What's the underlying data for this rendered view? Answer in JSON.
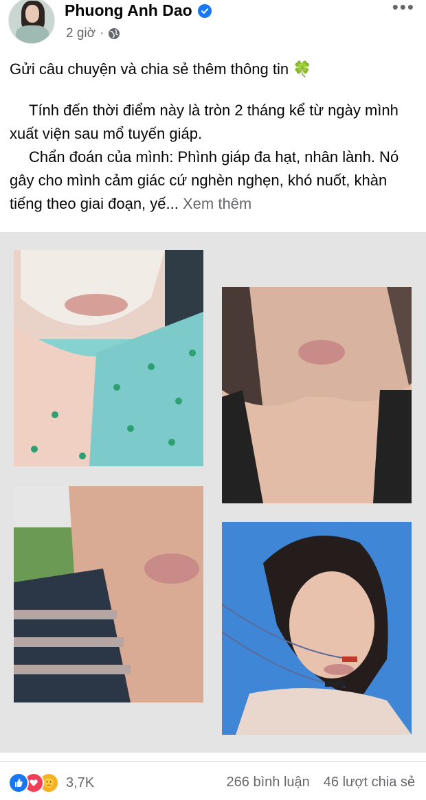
{
  "post": {
    "author": "Phuong Anh Dao",
    "time": "2 giờ",
    "title": "Gửi câu chuyện và chia sẻ thêm thông tin",
    "paragraph1": "Tính đến thời điểm này là tròn 2 tháng kể từ ngày mình xuất viện sau mổ tuyến giáp.",
    "paragraph2": "Chẩn đoán của mình: Phình giáp đa hạt, nhân lành. Nó gây cho mình cảm giác cứ nghèn nghẹn, khó nuốt, khàn tiếng theo giai đoạn, yế...",
    "see_more": "Xem thêm"
  },
  "footer": {
    "reaction_count": "3,7K",
    "comments": "266 bình luận",
    "shares": "46 lượt chia sẻ"
  },
  "icons": {
    "verified": "verified-badge-icon",
    "audience": "globe-icon",
    "more": "more-options-icon",
    "clover": "four-leaf-clover-emoji",
    "reactions": [
      "like-icon",
      "love-icon",
      "care-icon"
    ]
  },
  "colors": {
    "accent": "#1877f2",
    "secondary_text": "#65676b",
    "love": "#f33e58",
    "care": "#f7b125"
  }
}
